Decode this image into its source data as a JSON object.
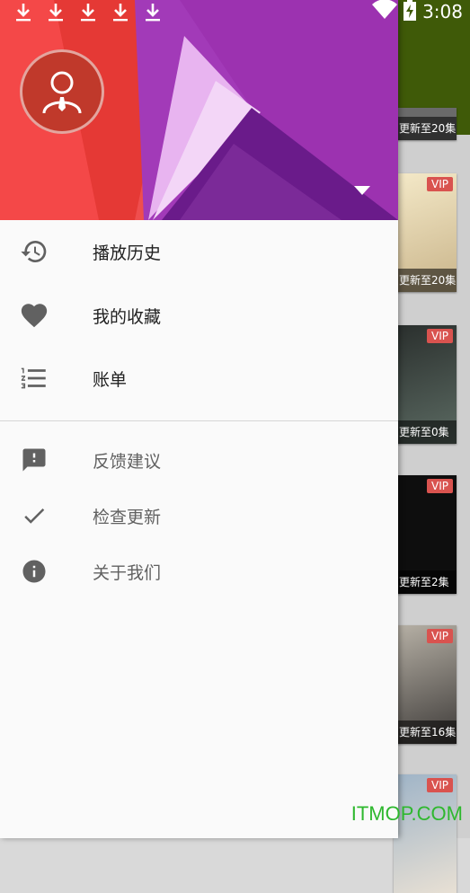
{
  "status_bar": {
    "time": "3:08",
    "download_icons": [
      "download-icon",
      "download-icon",
      "download-icon",
      "download-icon",
      "download-icon"
    ]
  },
  "drawer": {
    "primary_items": [
      {
        "label": "播放历史",
        "icon": "history-icon"
      },
      {
        "label": "我的收藏",
        "icon": "heart-icon"
      },
      {
        "label": "账单",
        "icon": "numbered-list-icon"
      }
    ],
    "secondary_items": [
      {
        "label": "反馈建议",
        "icon": "feedback-icon"
      },
      {
        "label": "检查更新",
        "icon": "check-icon"
      },
      {
        "label": "关于我们",
        "icon": "info-icon"
      }
    ]
  },
  "background_list": {
    "cards": [
      {
        "badge": "",
        "caption": "更新至20集"
      },
      {
        "badge": "VIP",
        "caption": "更新至20集"
      },
      {
        "badge": "VIP",
        "caption": "更新至0集"
      },
      {
        "badge": "VIP",
        "caption": "更新至2集"
      },
      {
        "badge": "VIP",
        "caption": "更新至16集"
      },
      {
        "badge": "VIP",
        "caption": ""
      }
    ]
  },
  "watermark": "ITMOP.COM",
  "colors": {
    "header_red": "#f44336",
    "header_purple": "#8e24aa",
    "toolbar_green": "#3f5a08",
    "icon_gray": "#616161",
    "watermark_green": "#2eb82e"
  }
}
